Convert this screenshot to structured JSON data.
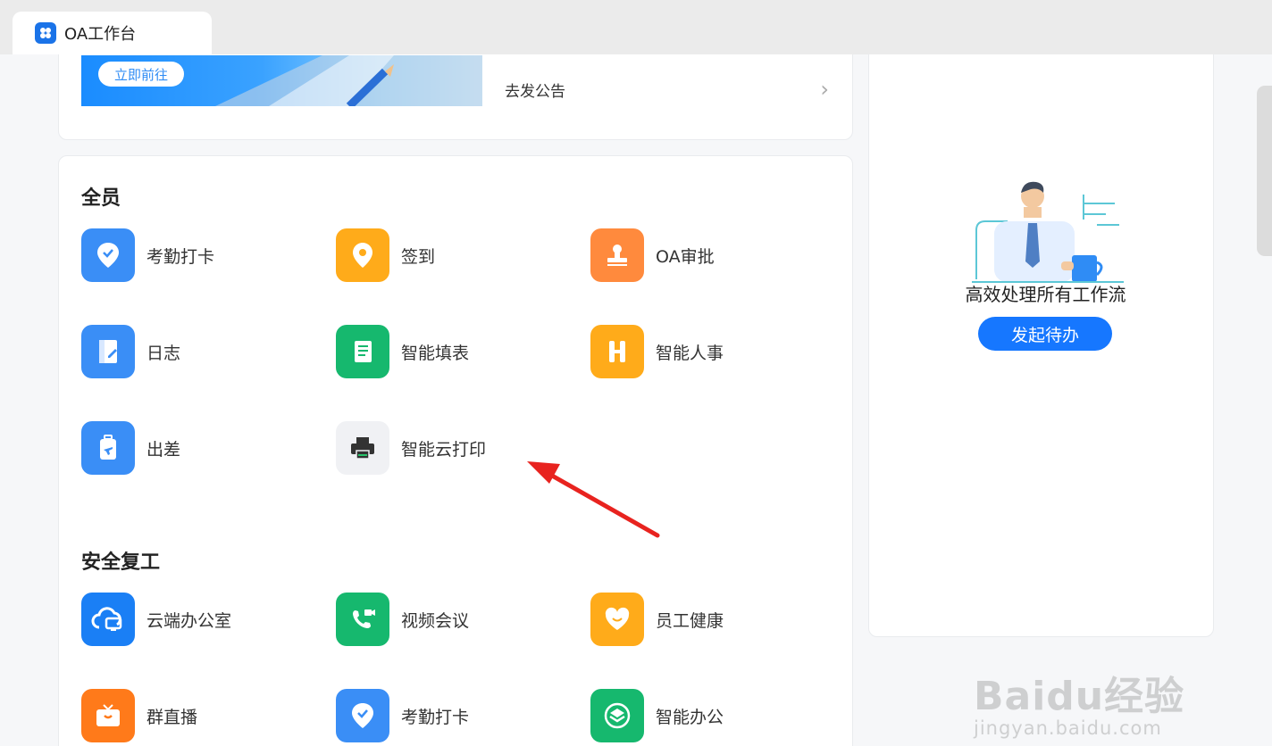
{
  "tab": {
    "title": "OA工作台"
  },
  "top_card": {
    "banner_button": "立即前往",
    "announce_label": "去发公告"
  },
  "sections": [
    {
      "title": "全员",
      "apps": [
        {
          "label": "考勤打卡",
          "icon": "location-check-icon",
          "color": "#3a8ef6"
        },
        {
          "label": "签到",
          "icon": "map-pin-icon",
          "color": "#ffab1a"
        },
        {
          "label": "OA审批",
          "icon": "stamp-icon",
          "color": "#ff8a3d"
        },
        {
          "label": "日志",
          "icon": "journal-icon",
          "color": "#3a8ef6"
        },
        {
          "label": "智能填表",
          "icon": "form-sheet-icon",
          "color": "#16b86e"
        },
        {
          "label": "智能人事",
          "icon": "hr-h-icon",
          "color": "#ffab1a"
        },
        {
          "label": "出差",
          "icon": "suitcase-plane-icon",
          "color": "#3a8ef6"
        },
        {
          "label": "智能云打印",
          "icon": "printer-icon",
          "color": "#f0f1f4"
        }
      ]
    },
    {
      "title": "安全复工",
      "apps": [
        {
          "label": "云端办公室",
          "icon": "cloud-monitor-icon",
          "color": "#1a7ff5"
        },
        {
          "label": "视频会议",
          "icon": "video-call-icon",
          "color": "#16b86e"
        },
        {
          "label": "员工健康",
          "icon": "heart-smile-icon",
          "color": "#ffab1a"
        },
        {
          "label": "群直播",
          "icon": "live-tv-icon",
          "color": "#ff7a1a"
        },
        {
          "label": "考勤打卡",
          "icon": "location-check-icon",
          "color": "#3a8ef6"
        },
        {
          "label": "智能办公",
          "icon": "layers-icon",
          "color": "#16b86e"
        }
      ]
    }
  ],
  "right_panel": {
    "text": "高效处理所有工作流",
    "button": "发起待办"
  },
  "watermark": {
    "main": "Baidu经验",
    "sub": "jingyan.baidu.com"
  }
}
